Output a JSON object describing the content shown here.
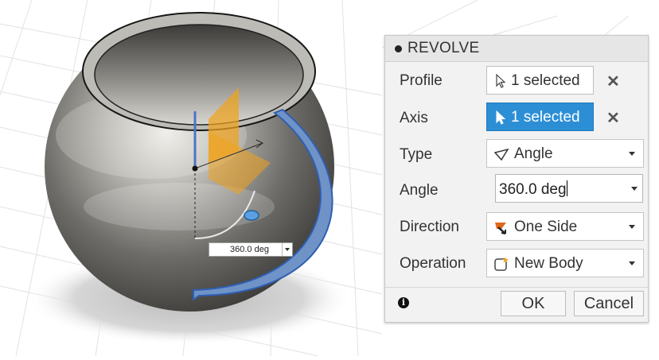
{
  "dialog": {
    "title": "REVOLVE",
    "rows": {
      "profile": {
        "label": "Profile",
        "value": "1 selected",
        "clear": "✕"
      },
      "axis": {
        "label": "Axis",
        "value": "1 selected",
        "clear": "✕"
      },
      "type": {
        "label": "Type",
        "value": "Angle"
      },
      "angle": {
        "label": "Angle",
        "value": "360.0 deg"
      },
      "direction": {
        "label": "Direction",
        "value": "One Side"
      },
      "operation": {
        "label": "Operation",
        "value": "New Body"
      }
    },
    "ok_label": "OK",
    "cancel_label": "Cancel",
    "info_glyph": "i"
  },
  "viewport": {
    "angle_field_value": "360.0 deg"
  },
  "colors": {
    "accent_blue": "#2c8fd6",
    "axis_blue": "#4a76c4",
    "plane_orange": "#f0a21c",
    "sphere_gray": "#6b6a67"
  }
}
